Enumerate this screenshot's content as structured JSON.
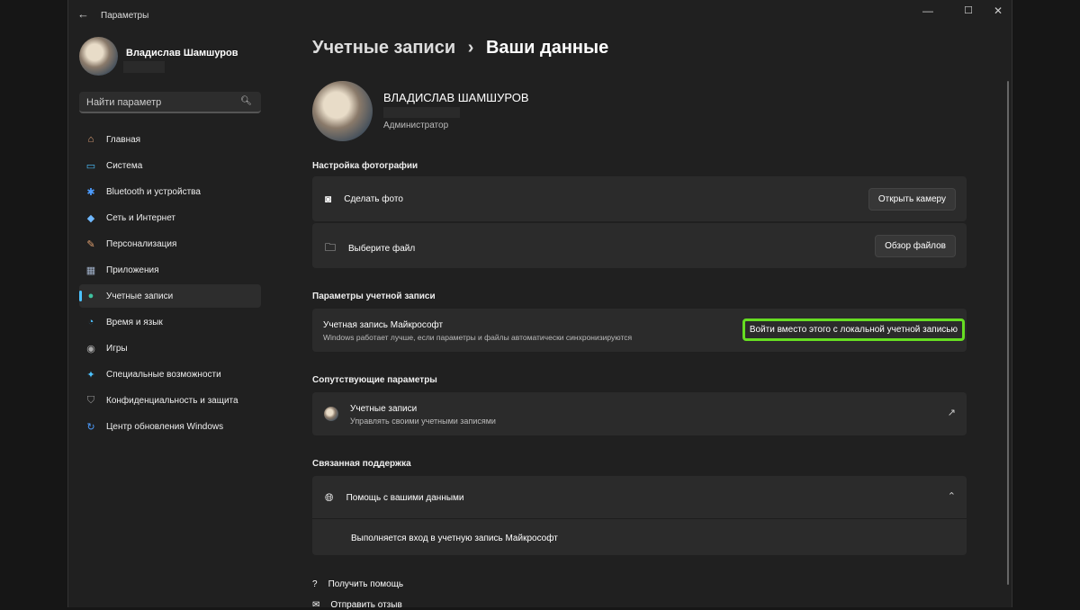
{
  "window": {
    "title": "Параметры",
    "back": "←",
    "minimize": "—",
    "maximize": "☐",
    "close": "✕"
  },
  "user": {
    "name": "Владислав Шамшуров",
    "name_upper": "ВЛАДИСЛАВ ШАМШУРОВ",
    "role": "Администратор"
  },
  "search": {
    "placeholder": "Найти параметр"
  },
  "sidebar": {
    "items": [
      {
        "label": "Главная",
        "icon": "⌂",
        "color": "#e8a87c"
      },
      {
        "label": "Система",
        "icon": "▭",
        "color": "#4cc2ff"
      },
      {
        "label": "Bluetooth и устройства",
        "icon": "✱",
        "color": "#4c9cff"
      },
      {
        "label": "Сеть и Интернет",
        "icon": "◆",
        "color": "#6fb8ff"
      },
      {
        "label": "Персонализация",
        "icon": "✎",
        "color": "#e0a070"
      },
      {
        "label": "Приложения",
        "icon": "▦",
        "color": "#a0b0c8"
      },
      {
        "label": "Учетные записи",
        "icon": "●",
        "color": "#3fc2a0"
      },
      {
        "label": "Время и язык",
        "icon": "◔",
        "color": "#4cc2ff"
      },
      {
        "label": "Игры",
        "icon": "◉",
        "color": "#aaaaaa"
      },
      {
        "label": "Специальные возможности",
        "icon": "✦",
        "color": "#4cc2ff"
      },
      {
        "label": "Конфиденциальность и защита",
        "icon": "⛉",
        "color": "#999999"
      },
      {
        "label": "Центр обновления Windows",
        "icon": "↻",
        "color": "#4c9cff"
      }
    ],
    "selected": 6
  },
  "breadcrumb": {
    "parent": "Учетные записи",
    "sep": "›",
    "current": "Ваши данные"
  },
  "photo": {
    "heading": "Настройка фотографии",
    "take_label": "Сделать фото",
    "take_button": "Открыть камеру",
    "file_label": "Выберите файл",
    "file_button": "Обзор файлов"
  },
  "account": {
    "heading": "Параметры учетной записи",
    "title": "Учетная запись Майкрософт",
    "desc": "Windows работает лучше, если параметры и файлы автоматически синхронизируются",
    "button": "Войти вместо этого с локальной учетной записью",
    "highlight": "#66dd22"
  },
  "related": {
    "heading": "Сопутствующие параметры",
    "title": "Учетные записи",
    "desc": "Управлять своими учетными записями"
  },
  "support": {
    "heading": "Связанная поддержка",
    "title": "Помощь с вашими данными",
    "item": "Выполняется вход в учетную запись Майкрософт"
  },
  "footer": {
    "help": "Получить помощь",
    "feedback": "Отправить отзыв"
  }
}
